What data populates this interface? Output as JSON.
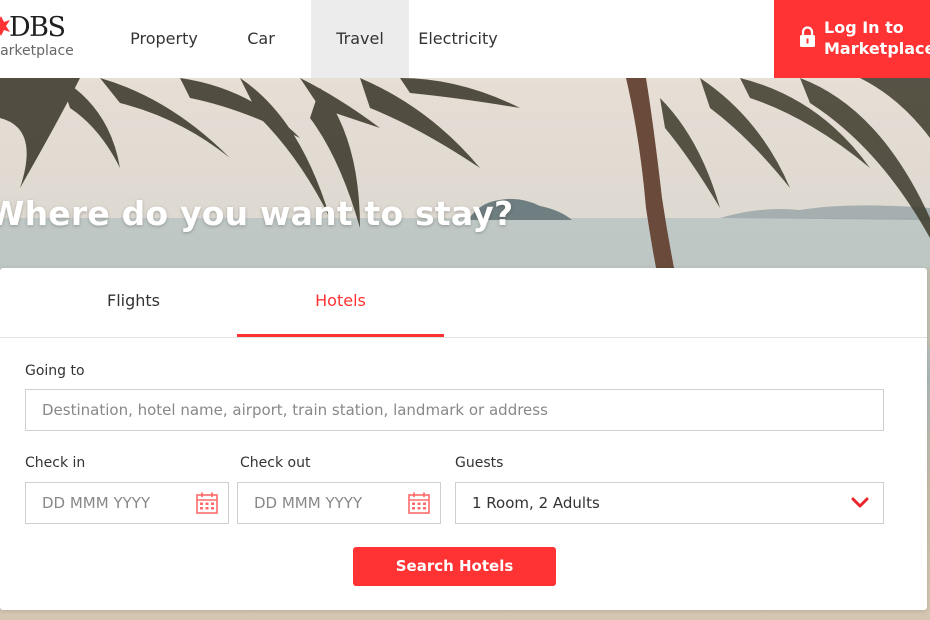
{
  "brand": {
    "name": "DBS",
    "subtitle": "Marketplace"
  },
  "nav": {
    "items": [
      {
        "label": "Property"
      },
      {
        "label": "Car"
      },
      {
        "label": "Travel",
        "active": true
      },
      {
        "label": "Electricity"
      }
    ],
    "login": {
      "line1": "Log In to",
      "line2": "Marketplace"
    }
  },
  "hero": {
    "title": "Where do you want to stay?"
  },
  "search": {
    "tabs": [
      {
        "label": "Flights"
      },
      {
        "label": "Hotels",
        "active": true
      }
    ],
    "going_to": {
      "label": "Going to",
      "placeholder": "Destination, hotel name, airport, train station, landmark or address",
      "value": ""
    },
    "check_in": {
      "label": "Check in",
      "placeholder": "DD MMM YYYY",
      "icon": "calendar-icon"
    },
    "check_out": {
      "label": "Check out",
      "placeholder": "DD MMM YYYY",
      "icon": "calendar-icon"
    },
    "guests": {
      "label": "Guests",
      "value": "1 Room, 2 Adults",
      "icon": "chevron-down-icon"
    },
    "submit_label": "Search Hotels"
  },
  "colors": {
    "accent": "#ff3333",
    "nav_active_bg": "#ececec",
    "border": "#cfcfcf"
  }
}
